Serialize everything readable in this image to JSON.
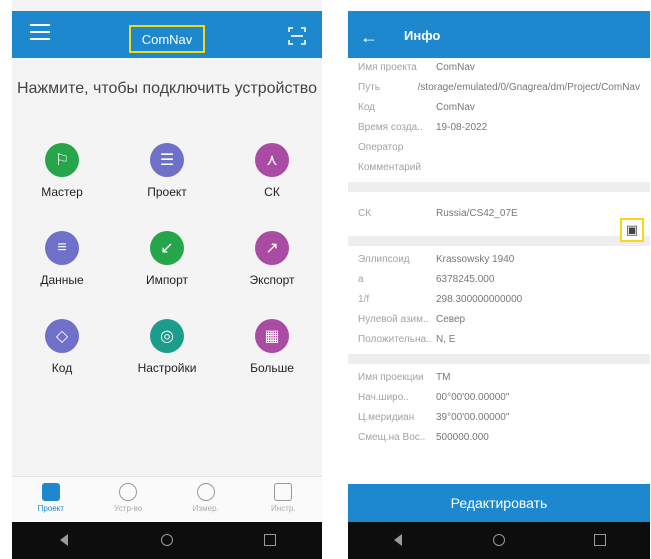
{
  "left": {
    "header": {
      "app_name": "ComNav"
    },
    "connect_prompt": "Нажмите, чтобы подключить устройство",
    "tiles": [
      {
        "label": "Мастер",
        "color": "#27a54a",
        "icon": "signpost-icon"
      },
      {
        "label": "Проект",
        "color": "#6f70c7",
        "icon": "document-icon"
      },
      {
        "label": "СК",
        "color": "#a94aa3",
        "icon": "tripod-icon"
      },
      {
        "label": "Данные",
        "color": "#6f70c7",
        "icon": "database-icon"
      },
      {
        "label": "Импорт",
        "color": "#27a54a",
        "icon": "import-icon"
      },
      {
        "label": "Экспорт",
        "color": "#a94aa3",
        "icon": "export-icon"
      },
      {
        "label": "Код",
        "color": "#6f70c7",
        "icon": "tag-icon"
      },
      {
        "label": "Настройки",
        "color": "#1c9d8c",
        "icon": "settings-icon"
      },
      {
        "label": "Больше",
        "color": "#a94aa3",
        "icon": "grid-icon"
      }
    ],
    "tabs": [
      {
        "label": "Проект",
        "active": true
      },
      {
        "label": "Устр-во",
        "active": false
      },
      {
        "label": "Измер.",
        "active": false
      },
      {
        "label": "Инстр.",
        "active": false
      }
    ]
  },
  "right": {
    "header": {
      "title": "Инфо"
    },
    "group1": [
      {
        "k": "Имя проекта",
        "v": "ComNav"
      },
      {
        "k": "Путь",
        "v": "/storage/emulated/0/Gnagrea/dm/Project/ComNav"
      },
      {
        "k": "Код",
        "v": "ComNav"
      },
      {
        "k": "Время созда..",
        "v": "19-08-2022"
      },
      {
        "k": "Оператор",
        "v": ""
      },
      {
        "k": "Комментарий",
        "v": ""
      }
    ],
    "ck": {
      "k": "СК",
      "v": "Russia/CS42_07E"
    },
    "group2": [
      {
        "k": "Эллипсоид",
        "v": "Krassowsky 1940"
      },
      {
        "k": "a",
        "v": "6378245.000"
      },
      {
        "k": "1/f",
        "v": "298.300000000000"
      },
      {
        "k": "Нулевой азим..",
        "v": "Север"
      },
      {
        "k": "Положительна..",
        "v": "N, E"
      }
    ],
    "group3": [
      {
        "k": "Имя проекции",
        "v": "TM"
      },
      {
        "k": "Нач.широ..",
        "v": "00°00'00.00000\""
      },
      {
        "k": "Ц.меридиан",
        "v": "39°00'00.00000\""
      },
      {
        "k": "Смещ.на Вос..",
        "v": "500000.000"
      }
    ],
    "edit_label": "Редактировать"
  }
}
